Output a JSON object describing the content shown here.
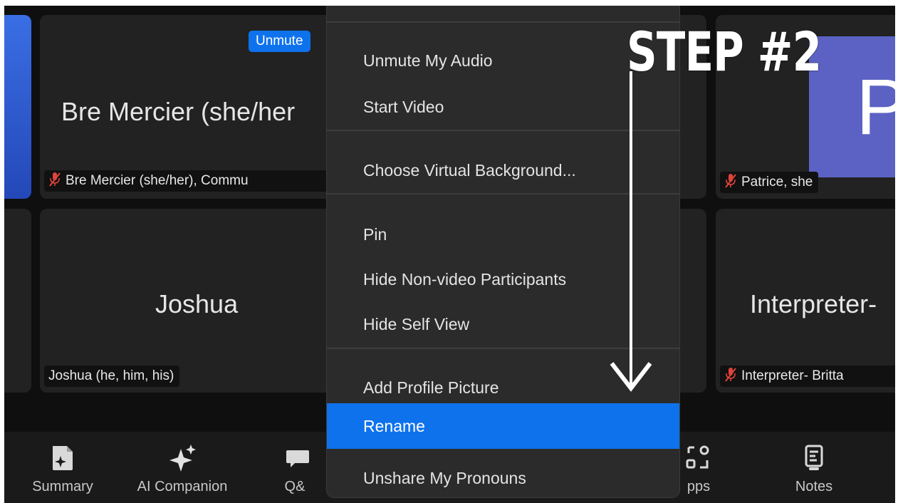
{
  "tiles": {
    "bre": {
      "display_name": "Bre Mercier (she/her",
      "tag": "Bre Mercier (she/her), Commu",
      "muted": true,
      "unmute_label": "Unmute"
    },
    "joshua": {
      "display_name": "Joshua",
      "tag": "Joshua (he, him, his)",
      "muted": false
    },
    "patrice": {
      "avatar_letter": "P",
      "tag": "Patrice, she",
      "muted": true
    },
    "interpreter": {
      "display_name": "Interpreter-",
      "tag": "Interpreter- Britta",
      "muted": true
    }
  },
  "context_menu": {
    "items": [
      {
        "label": "Unmute My Audio"
      },
      {
        "label": "Start Video"
      },
      {
        "label": "Choose Virtual Background..."
      },
      {
        "label": "Pin"
      },
      {
        "label": "Hide Non-video Participants"
      },
      {
        "label": "Hide Self View"
      },
      {
        "label": "Add Profile Picture"
      },
      {
        "label": "Rename",
        "selected": true
      },
      {
        "label": "Unshare My Pronouns"
      }
    ]
  },
  "toolbar": {
    "items": [
      {
        "label": "Summary",
        "icon": "summary-icon"
      },
      {
        "label": "AI Companion",
        "icon": "sparkle-icon"
      },
      {
        "label": "Q&",
        "icon": "qa-icon"
      },
      {
        "label": "pps",
        "icon": "apps-icon"
      },
      {
        "label": "Notes",
        "icon": "notes-icon"
      }
    ]
  },
  "annotation": {
    "step_label": "STEP #2",
    "arrow_color": "#ffffff"
  },
  "colors": {
    "accent": "#0e72ed",
    "avatar": "#5b62c4",
    "muted_icon": "#e0433a",
    "tile_bg": "#222222",
    "menu_bg": "#2b2b2b"
  }
}
